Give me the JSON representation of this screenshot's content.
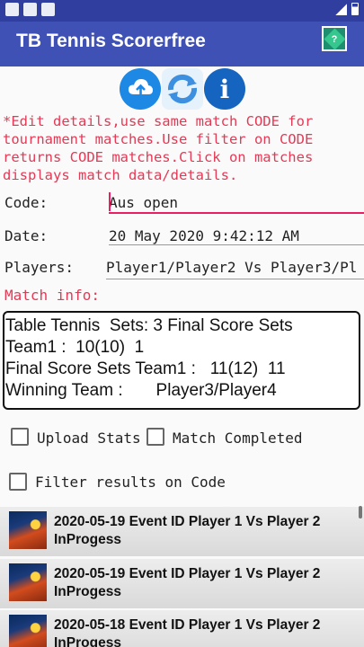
{
  "app": {
    "title": "TB Tennis Scorerfree"
  },
  "toolbar": {
    "icons": [
      "cloud-upload-icon",
      "refresh-icon",
      "info-icon"
    ],
    "info_glyph": "i",
    "help_glyph": "?"
  },
  "instructions": "*Edit details,use same match CODE for\ntournament matches.Use filter on CODE\nreturns CODE matches.Click on matches\ndisplays match data/details.",
  "form": {
    "code_label": "Code:",
    "code_value": "Aus open",
    "date_label": "Date:",
    "date_value": "20 May 2020 9:42:12 AM",
    "players_label": "Players:",
    "players_value": "Player1/Player2 Vs Player3/Pl"
  },
  "match_info": {
    "label": "Match info:",
    "text": "Table Tennis  Sets: 3 Final Score Sets\nTeam1 :  10(10)  1\nFinal Score Sets Team1 :   11(12)  11\nWinning Team :       Player3/Player4"
  },
  "options": {
    "upload_stats": "Upload Stats",
    "match_completed": "Match Completed",
    "filter_results": "Filter results on Code"
  },
  "matches": [
    {
      "line1": "2020-05-19 Event ID Player 1 Vs Player 2",
      "line2": "InProgess"
    },
    {
      "line1": "2020-05-19 Event ID Player 1 Vs Player 2",
      "line2": "InProgess"
    },
    {
      "line1": "2020-05-18 Event ID Player 1 Vs Player 2",
      "line2": "InProgess"
    }
  ],
  "colors": {
    "app_bar": "#3f51b5",
    "status_bar": "#303f9f",
    "accent": "#e91e63",
    "instruction_text": "#e53955"
  }
}
